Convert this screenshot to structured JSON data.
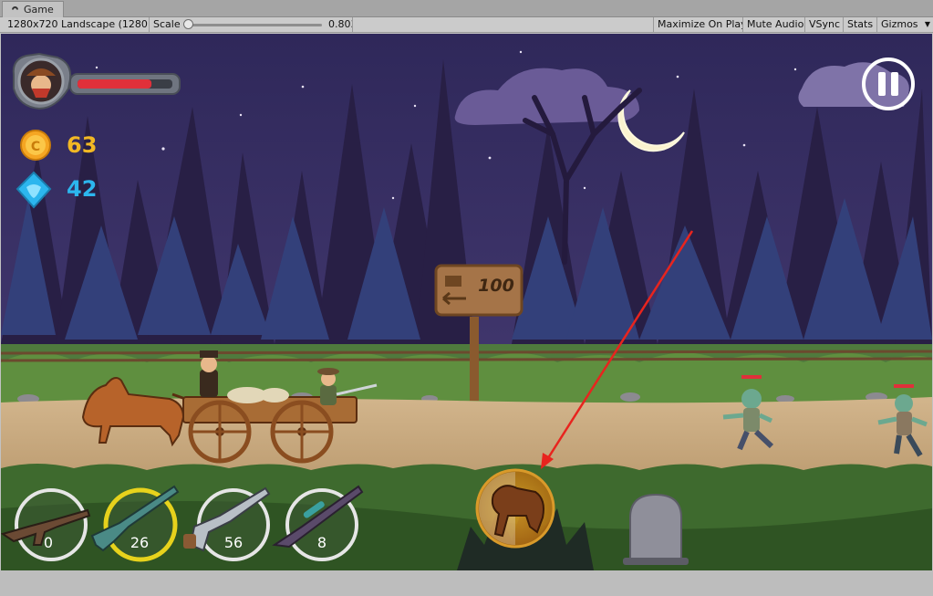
{
  "window": {
    "tab_title": "Game"
  },
  "toolbar": {
    "resolution": "1280x720 Landscape (1280",
    "scale_label": "Scale",
    "scale_value": "0.803",
    "maximize_on_play": "Maximize On Play",
    "mute_audio": "Mute Audio",
    "vsync": "VSync",
    "stats": "Stats",
    "gizmos": "Gizmos"
  },
  "hud": {
    "health_fraction": 0.78,
    "coins": "63",
    "gems": "42"
  },
  "signpost": {
    "distance": "100"
  },
  "weapons": [
    {
      "name": "assault-rifle",
      "ammo": "0",
      "selected": false
    },
    {
      "name": "shotgun",
      "ammo": "26",
      "selected": true
    },
    {
      "name": "revolver",
      "ammo": "56",
      "selected": false
    },
    {
      "name": "sniper-rifle",
      "ammo": "8",
      "selected": false
    }
  ],
  "colors": {
    "coin_text": "#f2b824",
    "gem_text": "#2cb6ee",
    "health_red": "#e0303a",
    "selected_ring": "#e7d21c",
    "annotation_arrow": "#e8241e"
  }
}
